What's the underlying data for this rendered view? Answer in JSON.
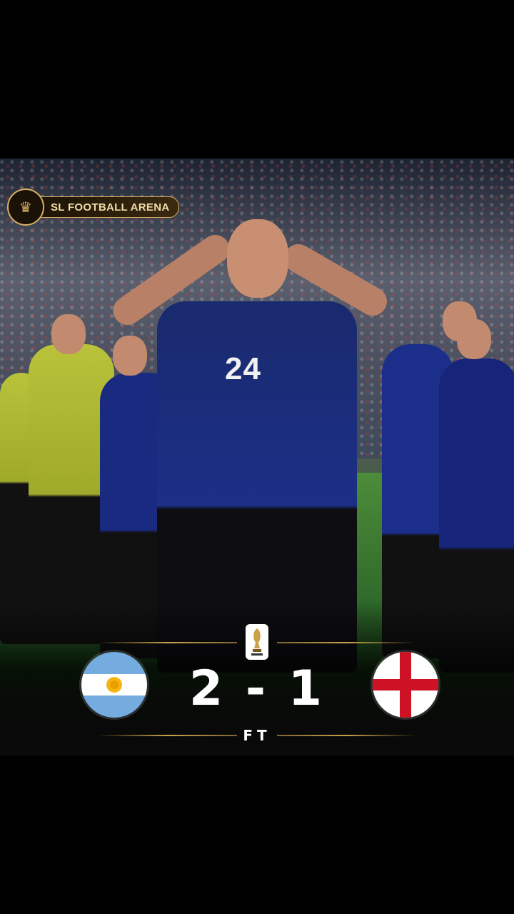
{
  "watermark": {
    "label": "SL FOOTBALL ARENA",
    "logo_icon": "lion-crest-icon"
  },
  "player": {
    "shirt_number": "24"
  },
  "match": {
    "home_team_flag": "argentina-flag-icon",
    "away_team_flag": "england-flag-icon",
    "score": "2 - 1",
    "status": "FT",
    "tournament_icon": "fifa-world-cup-trophy-icon"
  },
  "colors": {
    "accent_gold": "#c9a24a",
    "argentina_blue": "#74acdf",
    "england_red": "#ce1124"
  }
}
